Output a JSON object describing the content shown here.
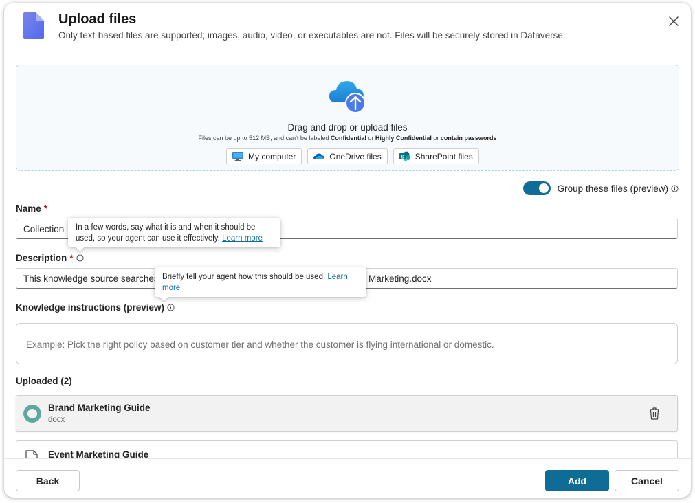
{
  "dialog": {
    "title": "Upload files",
    "subtitle": "Only text-based files are supported; images, audio, video, or executables are not. Files will be securely stored in Dataverse."
  },
  "dropzone": {
    "title": "Drag and drop or upload files",
    "note_prefix": "Files can be up to 512 MB, and can't be labeled ",
    "note_b1": "Confidential",
    "note_or": " or ",
    "note_b2": "Highly Confidential",
    "note_or2": " or ",
    "note_b3": "contain passwords",
    "sources": [
      {
        "label": "My computer",
        "icon": "monitor-icon"
      },
      {
        "label": "OneDrive files",
        "icon": "onedrive-icon"
      },
      {
        "label": "SharePoint files",
        "icon": "sharepoint-icon"
      }
    ]
  },
  "group_toggle": {
    "label": "Group these files (preview)",
    "on": true
  },
  "name_field": {
    "label": "Name",
    "required_mark": "*",
    "value_visible": "Collection "
  },
  "description_field": {
    "label": "Description",
    "required_mark": "*",
    "value_left": "This knowledge source searches",
    "value_right": "Marketing.docx"
  },
  "knowledge_instructions": {
    "label": "Knowledge instructions (preview)",
    "placeholder": "Example: Pick the right policy based on customer tier and whether the customer is flying international or domestic."
  },
  "tooltips": {
    "name_tip": {
      "text": "In a few words, say what it is and when it should be used, so your agent can use it effectively.",
      "link": "Learn more"
    },
    "description_tip": {
      "text": "Briefly tell your agent how this should be used.",
      "link": "Learn more"
    }
  },
  "uploaded": {
    "label": "Uploaded (2)",
    "files": [
      {
        "name": "Brand Marketing Guide",
        "type": "docx"
      },
      {
        "name": "Event Marketing Guide",
        "type": ""
      }
    ]
  },
  "footer": {
    "back_label": "Back",
    "add_label": "Add",
    "cancel_label": "Cancel"
  },
  "colors": {
    "accent": "#0f6c96",
    "required": "#c50f1f",
    "dropzone_border": "#a9d2ee"
  }
}
